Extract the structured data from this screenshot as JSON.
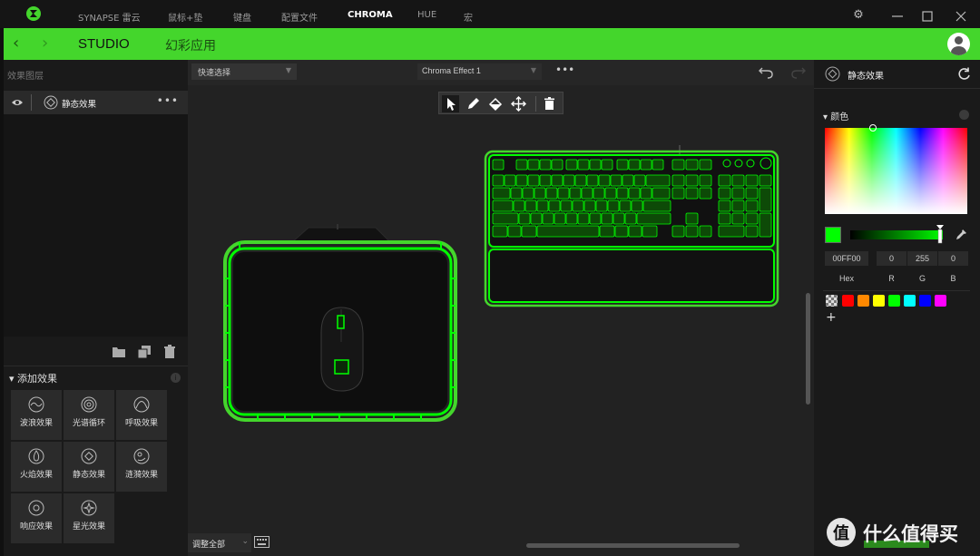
{
  "titlebar": {
    "nav": [
      "SYNAPSE 雷云",
      "鼠标+垫",
      "键盘",
      "配置文件",
      "CHROMA",
      "HUE",
      "宏"
    ],
    "active": "CHROMA",
    "icons": [
      "razer-logo",
      "gear-icon",
      "minimize-icon",
      "maximize-icon",
      "close-icon"
    ]
  },
  "header": {
    "studio": "STUDIO",
    "apps": "幻彩应用",
    "accent": "#44d62c"
  },
  "left": {
    "title": "效果图层",
    "layer": {
      "name": "静态效果"
    },
    "add_effects_title": "添加效果",
    "effects": [
      "波浪效果",
      "光谱循环",
      "呼吸效果",
      "火焰效果",
      "静态效果",
      "涟漪效果",
      "响应效果",
      "星光效果"
    ],
    "adjust_all": "调整全部"
  },
  "canvas": {
    "quick_select": "快速选择",
    "effect": "Chroma Effect 1"
  },
  "right": {
    "title": "静态效果",
    "color_title": "颜色",
    "hex": "00FF00",
    "r": "0",
    "g": "255",
    "b": "0",
    "hex_label": "Hex",
    "r_label": "R",
    "g_label": "G",
    "b_label": "B",
    "selected_color": "#00ff00",
    "presets": [
      "#ff0000",
      "#ff8800",
      "#ffff00",
      "#00ff00",
      "#00ffff",
      "#0000ff",
      "#ff00ff"
    ]
  },
  "watermark": {
    "text": "什么值得买"
  }
}
